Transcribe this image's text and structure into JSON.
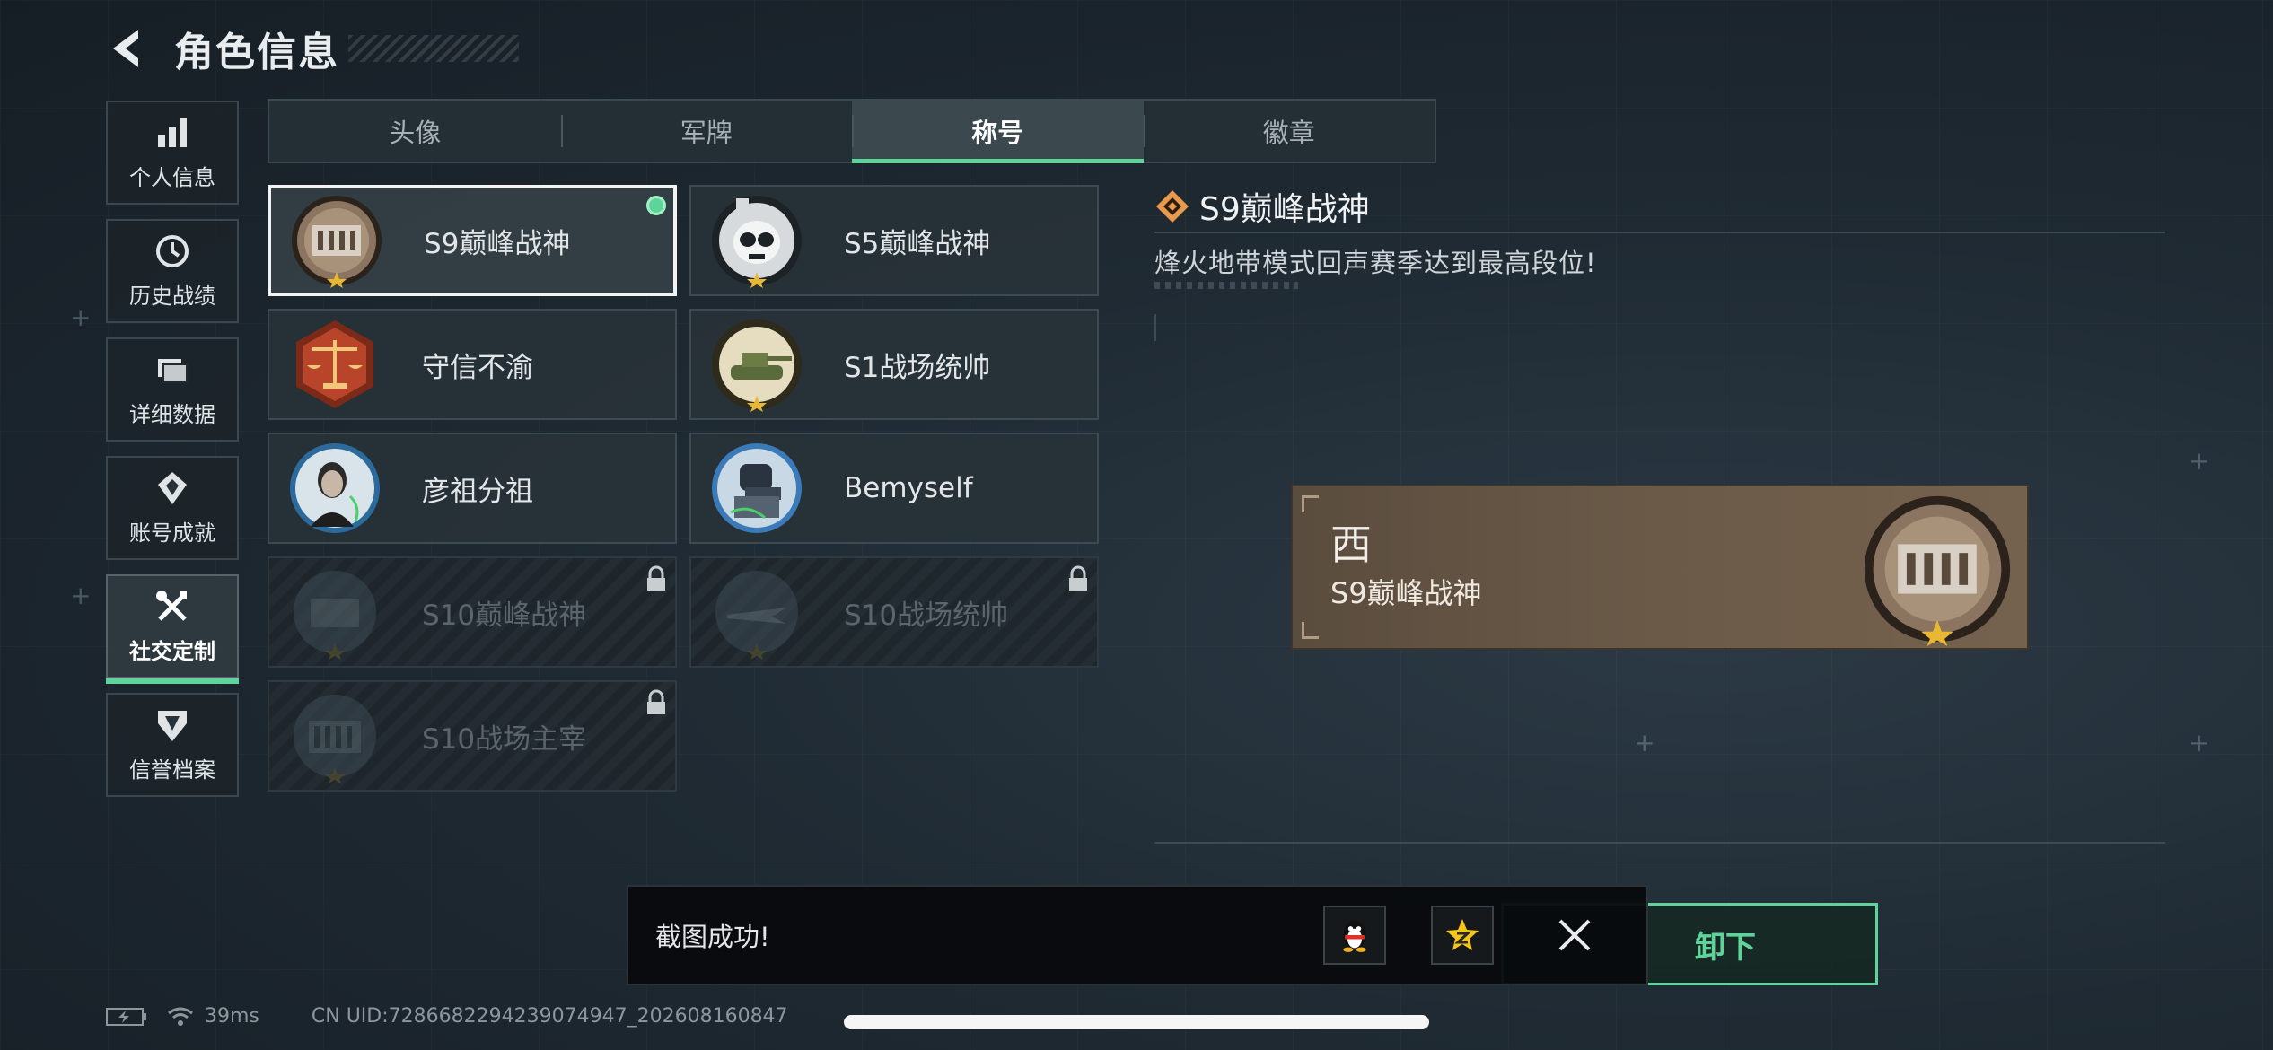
{
  "header": {
    "title": "角色信息"
  },
  "sidebar": {
    "items": [
      {
        "label": "个人信息",
        "icon": "bar-chart-icon"
      },
      {
        "label": "历史战绩",
        "icon": "clock-icon"
      },
      {
        "label": "详细数据",
        "icon": "folder-icon"
      },
      {
        "label": "账号成就",
        "icon": "achievement-icon"
      },
      {
        "label": "社交定制",
        "icon": "tools-icon",
        "active": true
      },
      {
        "label": "信誉档案",
        "icon": "shield-icon"
      }
    ]
  },
  "tabs": [
    {
      "label": "头像"
    },
    {
      "label": "军牌"
    },
    {
      "label": "称号",
      "active": true
    },
    {
      "label": "徽章"
    }
  ],
  "titles": [
    {
      "label": "S9巅峰战神",
      "medal": "fortress-medal-icon",
      "state": "equipped"
    },
    {
      "label": "S5巅峰战神",
      "medal": "skull-medal-icon",
      "state": "owned"
    },
    {
      "label": "守信不渝",
      "medal": "scales-medal-icon",
      "state": "owned"
    },
    {
      "label": "S1战场统帅",
      "medal": "tank-medal-icon",
      "state": "owned"
    },
    {
      "label": "彦祖分祖",
      "medal": "portrait-medal-icon",
      "state": "owned"
    },
    {
      "label": "Bemyself",
      "medal": "soldier-medal-icon",
      "state": "owned"
    },
    {
      "label": "S10巅峰战神",
      "medal": "fortress-medal-icon",
      "state": "locked"
    },
    {
      "label": "S10战场统帅",
      "medal": "jet-medal-icon",
      "state": "locked"
    },
    {
      "label": "S10战场主宰",
      "medal": "colosseum-medal-icon",
      "state": "locked"
    }
  ],
  "detail": {
    "title": "S9巅峰战神",
    "description": "烽火地带模式回声赛季达到最高段位!",
    "preview_name": "西",
    "preview_title": "S9巅峰战神"
  },
  "unequip_button": {
    "label": "卸下"
  },
  "toast": {
    "text": "截图成功!"
  },
  "footer": {
    "ping": "39ms",
    "uid": "CN UID:7286682294239074947_202608160847"
  },
  "colors": {
    "accent": "#5fd49a",
    "medal_bronze": "#8b7560",
    "card_bg": "#28323a"
  }
}
